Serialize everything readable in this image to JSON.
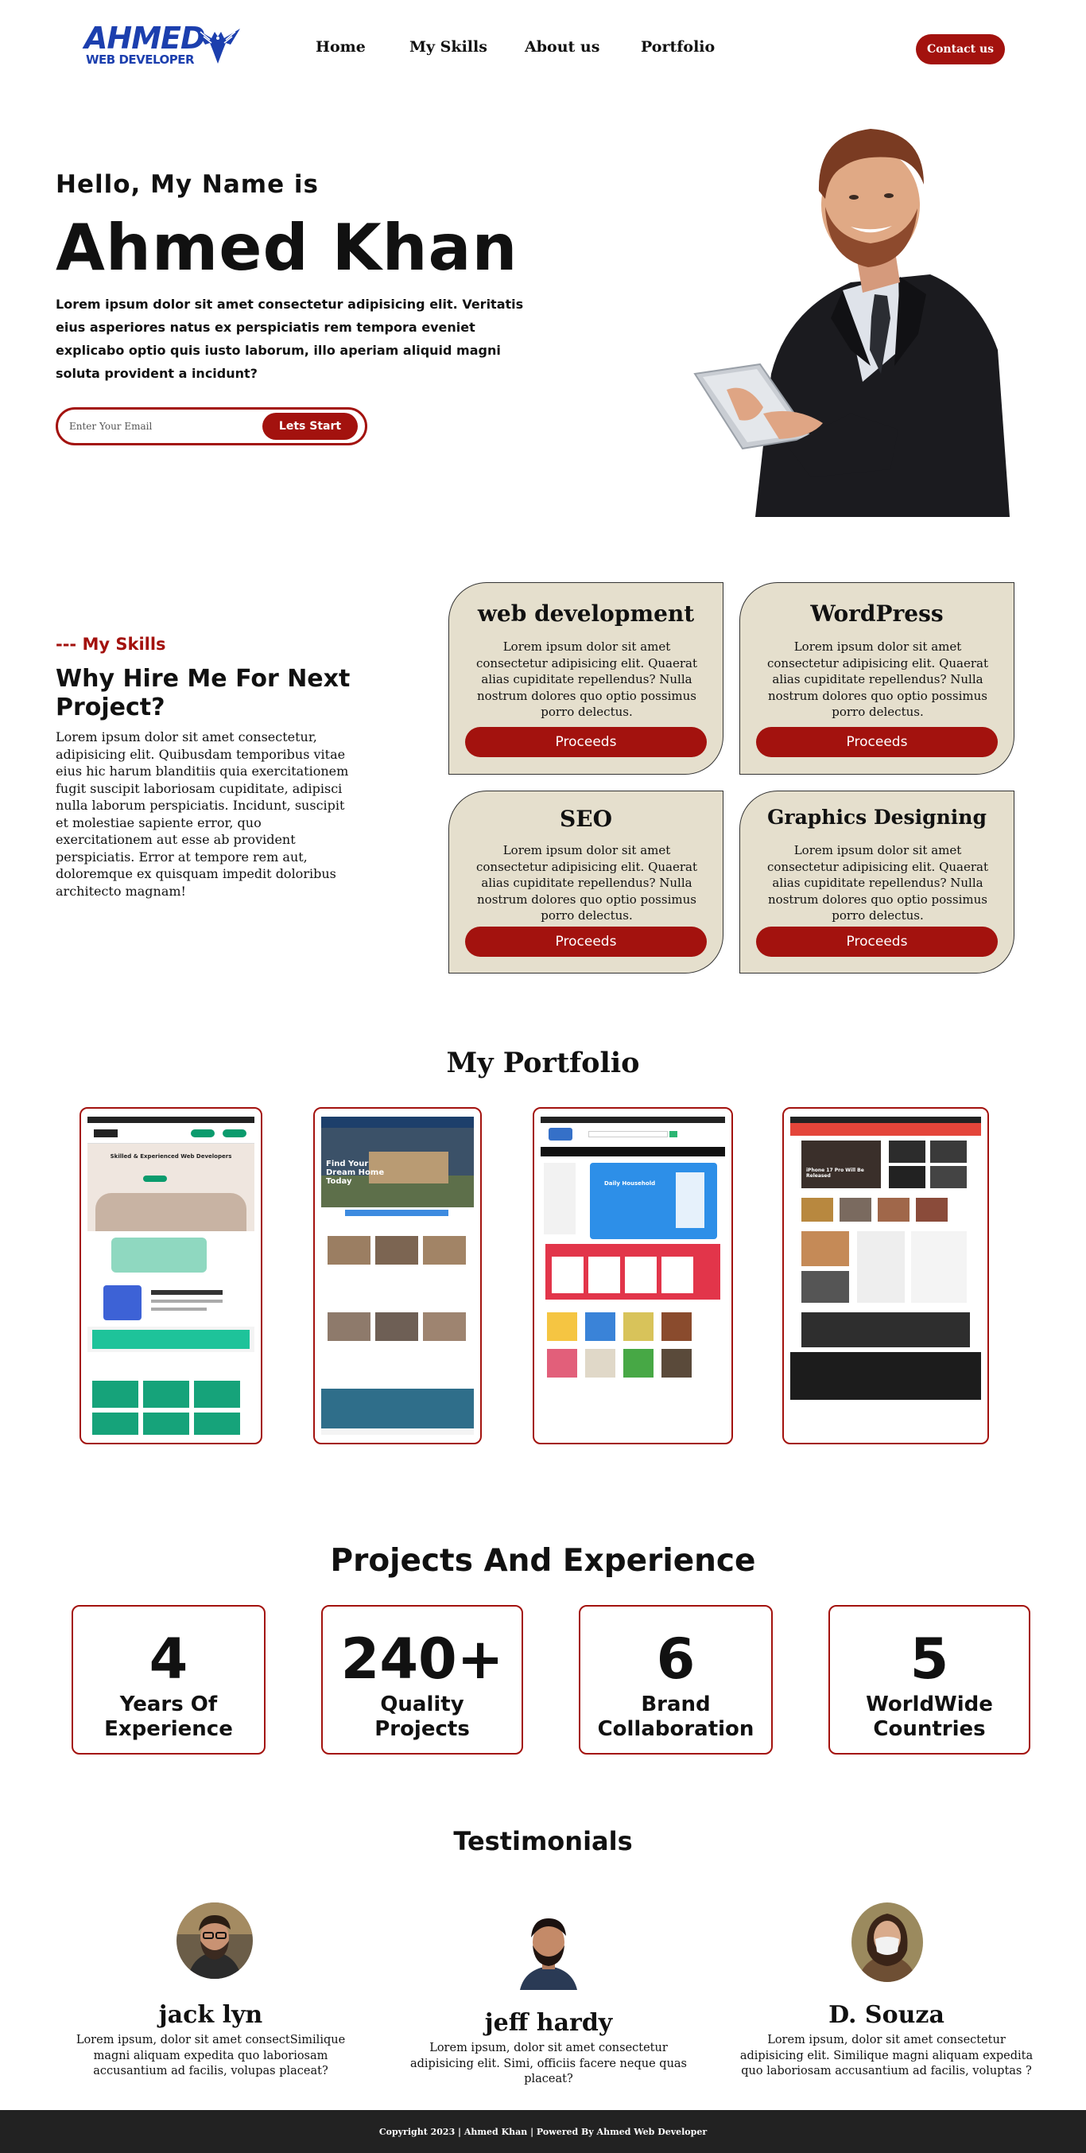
{
  "brand": {
    "name": "AHMED",
    "tagline": "WEB DEVELOPER"
  },
  "nav": {
    "items": [
      {
        "label": "Home"
      },
      {
        "label": "My Skills"
      },
      {
        "label": "About us"
      },
      {
        "label": "Portfolio"
      }
    ],
    "contact_label": "Contact us"
  },
  "hero": {
    "greeting": "Hello, My Name is",
    "name": "Ahmed Khan",
    "description": "Lorem ipsum dolor sit amet consectetur adipisicing elit. Veritatis eius asperiores natus ex perspiciatis rem tempora eveniet explicabo optio quis iusto laborum, illo aperiam aliquid magni soluta provident a incidunt?",
    "email_placeholder": "Enter Your Email",
    "cta_label": "Lets Start"
  },
  "skills": {
    "kicker": "--- My Skills",
    "title": "Why Hire Me For Next Project?",
    "description": "Lorem ipsum dolor sit amet consectetur, adipisicing elit. Quibusdam temporibus vitae eius hic harum blanditiis quia exercitationem fugit suscipit laboriosam cupiditate, adipisci nulla laborum perspiciatis. Incidunt, suscipit et molestiae sapiente error, quo exercitationem aut esse ab provident perspiciatis. Error at tempore rem aut, doloremque ex quisquam impedit doloribus architecto magnam!",
    "cards": [
      {
        "title": "web development",
        "text": "Lorem ipsum dolor sit amet consectetur adipisicing elit. Quaerat alias cupiditate repellendus? Nulla nostrum dolores quo optio possimus porro delectus.",
        "button": "Proceeds"
      },
      {
        "title": "WordPress",
        "text": "Lorem ipsum dolor sit amet consectetur adipisicing elit. Quaerat alias cupiditate repellendus? Nulla nostrum dolores quo optio possimus porro delectus.",
        "button": "Proceeds"
      },
      {
        "title": "SEO",
        "text": "Lorem ipsum dolor sit amet consectetur adipisicing elit. Quaerat alias cupiditate repellendus? Nulla nostrum dolores quo optio possimus porro delectus.",
        "button": "Proceeds"
      },
      {
        "title": "Graphics Designing",
        "text": "Lorem ipsum dolor sit amet consectetur adipisicing elit. Quaerat alias cupiditate repellendus? Nulla nostrum dolores quo optio possimus porro delectus.",
        "button": "Proceeds"
      }
    ]
  },
  "portfolio": {
    "title": "My Portfolio",
    "items": [
      {
        "thumb_text": "Skilled & Experienced Web Developers"
      },
      {
        "thumb_text": "Find Your Dream Home Today"
      },
      {
        "thumb_text": "Daily Household"
      },
      {
        "thumb_text": "iPhone 17 Pro Will Be Released"
      }
    ]
  },
  "stats": {
    "title": "Projects And Experience",
    "items": [
      {
        "value": "4",
        "label": "Years Of Experience"
      },
      {
        "value": "240+",
        "label": "Quality Projects"
      },
      {
        "value": "6",
        "label": "Brand Collaboration"
      },
      {
        "value": "5",
        "label": "WorldWide Countries"
      }
    ]
  },
  "testimonials": {
    "title": "Testimonials",
    "items": [
      {
        "name": "jack lyn",
        "text": "Lorem ipsum, dolor sit amet consectSimilique magni aliquam expedita quo laboriosam accusantium ad facilis, volupas placeat?"
      },
      {
        "name": "jeff hardy",
        "text": "Lorem ipsum, dolor sit amet consectetur adipisicing elit. Simi, officiis facere neque quas placeat?"
      },
      {
        "name": "D. Souza",
        "text": "Lorem ipsum, dolor sit amet consectetur adipisicing elit. Similique magni aliquam expedita quo laboriosam accusantium ad facilis, voluptas ?"
      }
    ]
  },
  "footer": {
    "text": "Copyright 2023 | Ahmed Khan | Powered By Ahmed Web Developer"
  },
  "colors": {
    "accent": "#a3120e",
    "brand_blue": "#1c3fae",
    "card_bg": "#e5dfcd",
    "footer_bg": "#222222"
  }
}
